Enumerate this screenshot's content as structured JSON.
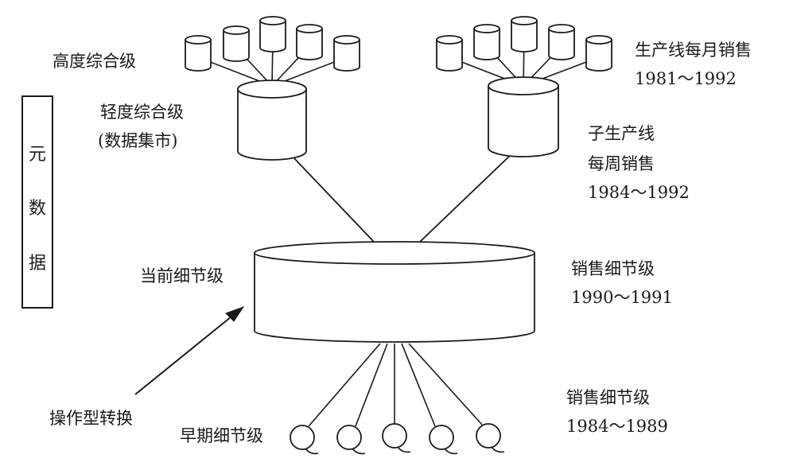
{
  "metadata_box": {
    "chars": [
      "元",
      "数",
      "据"
    ]
  },
  "labels": {
    "high_level": "高度综合级",
    "light_level_1": "轻度综合级",
    "light_level_2": "(数据集市)",
    "current_detail": "当前细节级",
    "operational_transform": "操作型转换",
    "early_detail": "早期细节级",
    "monthly_sales_1": "生产线每月销售",
    "monthly_sales_2": "1981～1992",
    "weekly_sales_1": "子生产线",
    "weekly_sales_2": "每周销售",
    "weekly_sales_3": "1984～1992",
    "sales_detail_current_1": "销售细节级",
    "sales_detail_current_2": "1990～1991",
    "sales_detail_early_1": "销售细节级",
    "sales_detail_early_2": "1984～1989"
  },
  "colors": {
    "stroke": "#1a1a1a",
    "fill": "#ffffff"
  }
}
